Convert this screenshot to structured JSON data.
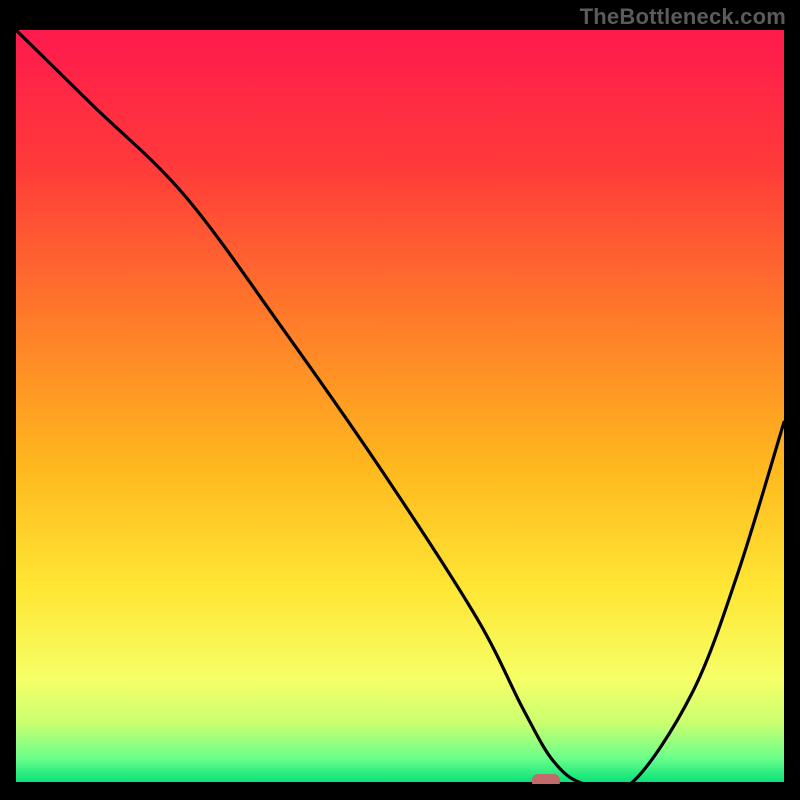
{
  "watermark": "TheBottleneck.com",
  "chart_data": {
    "type": "line",
    "title": "",
    "xlabel": "",
    "ylabel": "",
    "xlim": [
      0,
      100
    ],
    "ylim": [
      0,
      100
    ],
    "series": [
      {
        "name": "curve",
        "x": [
          0,
          10,
          22,
          35,
          48,
          60,
          66,
          70,
          74,
          80,
          88,
          94,
          100
        ],
        "values": [
          100,
          90,
          78,
          60,
          41,
          22,
          10,
          3,
          0,
          0,
          12,
          28,
          48
        ]
      }
    ],
    "marker": {
      "x": 69,
      "y": 0,
      "color": "#c26a6a"
    },
    "gradient_stops": [
      {
        "offset": 0.0,
        "color": "#ff1a4d"
      },
      {
        "offset": 0.18,
        "color": "#ff3a3a"
      },
      {
        "offset": 0.38,
        "color": "#ff7a2a"
      },
      {
        "offset": 0.58,
        "color": "#ffb81e"
      },
      {
        "offset": 0.74,
        "color": "#ffe634"
      },
      {
        "offset": 0.86,
        "color": "#f6ff66"
      },
      {
        "offset": 0.92,
        "color": "#c9ff70"
      },
      {
        "offset": 0.965,
        "color": "#6cff8a"
      },
      {
        "offset": 1.0,
        "color": "#00e079"
      }
    ]
  }
}
